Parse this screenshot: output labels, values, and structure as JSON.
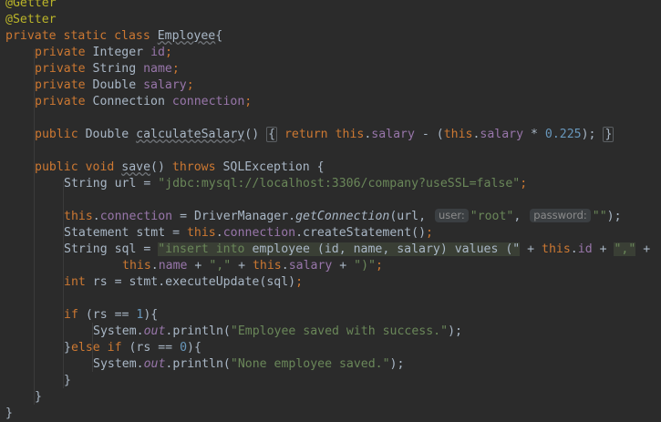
{
  "code": {
    "l0_an1": "@Getter",
    "l1_an2": "@Setter",
    "l2_kw": "private static class ",
    "l2_cls": "Employee",
    "l2_brace": "{",
    "l3_kw": "private ",
    "l3_type": "Integer ",
    "l3_fd": "id",
    "l3_semi": ";",
    "l4_kw": "private ",
    "l4_type": "String ",
    "l4_fd": "name",
    "l4_semi": ";",
    "l5_kw": "private ",
    "l5_type": "Double ",
    "l5_fd": "salary",
    "l5_semi": ";",
    "l6_kw": "private ",
    "l6_type": "Connection ",
    "l6_fd": "connection",
    "l6_semi": ";",
    "l8_kw": "public ",
    "l8_type": "Double ",
    "l8_m": "calculateSalary",
    "l8_paren": "()",
    "l8_fo": "{",
    "l8_ret": " return ",
    "l8_this1": "this",
    "l8_dot1": ".",
    "l8_fd1": "salary",
    "l8_op": " - (",
    "l8_this2": "this",
    "l8_dot2": ".",
    "l8_fd2": "salary",
    "l8_mul": " * ",
    "l8_num": "0.225",
    "l8_end": ");",
    "l8_fc": "}",
    "l10_kw": "public void ",
    "l10_m": "save",
    "l10_p": "() ",
    "l10_kw2": "throws ",
    "l10_ex": "SQLException {",
    "l11_a": "String url = ",
    "l11_s": "\"jdbc:mysql://localhost:3306/company?useSSL=false\"",
    "l11_semi": ";",
    "l13_this": "this",
    "l13_dot": ".",
    "l13_fd": "connection",
    "l13_a": " = DriverManager.",
    "l13_m": "getConnection",
    "l13_b": "(url, ",
    "l13_h1": "user:",
    "l13_s1": "\"root\"",
    "l13_c": ", ",
    "l13_h2": "password:",
    "l13_s2": "\"\"",
    "l13_end": ");",
    "l14_a": "Statement stmt = ",
    "l14_this": "this",
    "l14_dot": ".",
    "l14_fd": "connection",
    "l14_b": ".createStatement()",
    "l14_semi": ";",
    "l15_a": "String sql = ",
    "l15_s1": "\"insert into ",
    "l15_s2": "employee (id, name, salary) values (\"",
    "l15_b": " + ",
    "l15_this": "this",
    "l15_dot": ".",
    "l15_fd": "id",
    "l15_c": " + ",
    "l15_s3": "\",\"",
    "l15_d": " +",
    "l16_this1": "this",
    "l16_dot1": ".",
    "l16_fd1": "name",
    "l16_a": " + ",
    "l16_s1": "\",\"",
    "l16_b": " + ",
    "l16_this2": "this",
    "l16_dot2": ".",
    "l16_fd2": "salary",
    "l16_c": " + ",
    "l16_s2": "\")\"",
    "l16_semi": ";",
    "l17_kw": "int ",
    "l17_a": "rs = stmt.executeUpdate(sql)",
    "l17_semi": ";",
    "l19_kw": "if ",
    "l19_a": "(rs == ",
    "l19_n": "1",
    "l19_b": "){",
    "l20_a": "System.",
    "l20_out": "out",
    "l20_b": ".println(",
    "l20_s": "\"Employee saved with success.\"",
    "l20_end": ");",
    "l21_b": "}",
    "l21_kw": "else if ",
    "l21_a": "(rs == ",
    "l21_n": "0",
    "l21_c": "){",
    "l22_a": "System.",
    "l22_out": "out",
    "l22_b": ".println(",
    "l22_s": "\"None employee saved.\"",
    "l22_end": ");",
    "l23": "}",
    "l24": "}",
    "l25": "}"
  },
  "colors": {
    "background": "#2b2b2b",
    "keyword": "#cc7832",
    "annotation": "#bbb529",
    "field": "#9876aa",
    "string": "#6a8759",
    "number": "#6897bb",
    "text": "#a9b7c6"
  }
}
